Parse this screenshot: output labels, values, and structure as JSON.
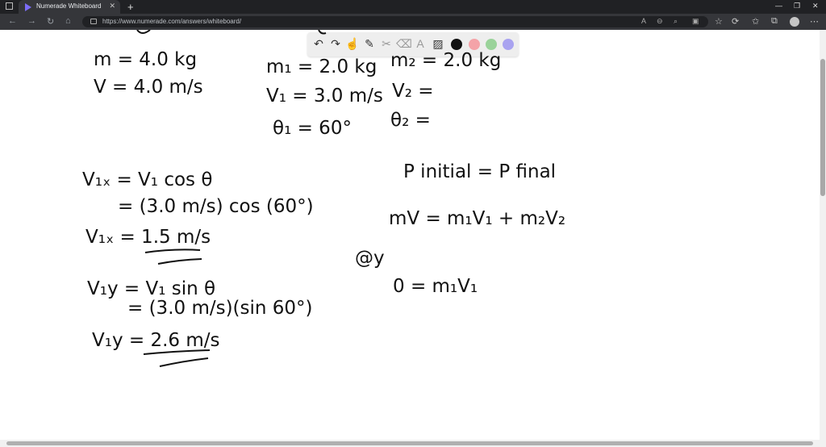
{
  "browser": {
    "tab_title": "Numerade Whiteboard",
    "url": "https://www.numerade.com/answers/whiteboard/",
    "new_tab": "+",
    "close": "✕"
  },
  "palette": {
    "colors": [
      "#111111",
      "#f4a3a8",
      "#9ad39a",
      "#a9a3f0"
    ]
  },
  "whiteboard": {
    "left_given": [
      "m = 4.0 kg",
      "V = 4.0 m/s"
    ],
    "m1": "m₁ = 2.0 kg",
    "v1": "V₁ = 3.0 m/s",
    "theta1": "θ₁ = 60°",
    "m2": "m₂ = 2.0 kg",
    "v2": "V₂ =",
    "theta2": "θ₂ =",
    "v1x_line1": "V₁ₓ = V₁ cos θ",
    "v1x_line2": "= (3.0 m/s) cos (60°)",
    "v1x_result": "V₁ₓ = 1.5 m/s",
    "v1y_line1": "V₁y = V₁ sin θ",
    "v1y_line2": "= (3.0 m/s)(sin 60°)",
    "v1y_result": "V₁y = 2.6 m/s",
    "momentum": "P initial = P final",
    "momentum_eq": "mV = m₁V₁ + m₂V₂",
    "at_y": "@y",
    "y_eq": "0 = m₁V₁"
  }
}
